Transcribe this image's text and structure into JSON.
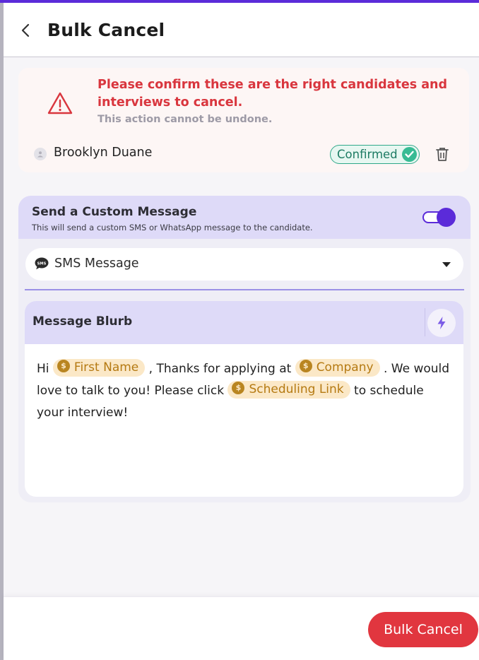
{
  "header": {
    "title": "Bulk Cancel",
    "back_icon": "chevron-left-icon"
  },
  "warning": {
    "title": "Please confirm these are the right candidates and interviews to cancel.",
    "subtitle": "This action cannot be undone.",
    "icon": "warning-triangle-icon",
    "color": "#d9363e"
  },
  "candidates": [
    {
      "name": "Brooklyn Duane",
      "status": "Confirmed",
      "status_icon": "check-circle-icon",
      "delete_icon": "trash-icon"
    }
  ],
  "custom_message": {
    "title": "Send a Custom Message",
    "description": "This will send a custom SMS or WhatsApp message to the candidate.",
    "toggle_on": true,
    "channel": {
      "selected": "SMS Message",
      "icon": "sms-bubble-icon"
    }
  },
  "blurb": {
    "title": "Message Blurb",
    "action_icon": "lightning-bolt-icon",
    "segments": {
      "t1": "Hi ",
      "v1": "First Name",
      "t2": " , Thanks for applying  at ",
      "v2": "Company",
      "t3": " . We would love to talk to you! Please click ",
      "v3": "Scheduling Link",
      "t4": " to schedule your interview!"
    },
    "variable_icon": "dollar-badge-icon"
  },
  "footer": {
    "cancel_label": "Bulk Cancel"
  },
  "colors": {
    "accent": "#5b2bd9",
    "danger": "#e1363f",
    "success": "#37bb94",
    "chip_bg": "#fbe8c7",
    "chip_text": "#b57a12"
  }
}
